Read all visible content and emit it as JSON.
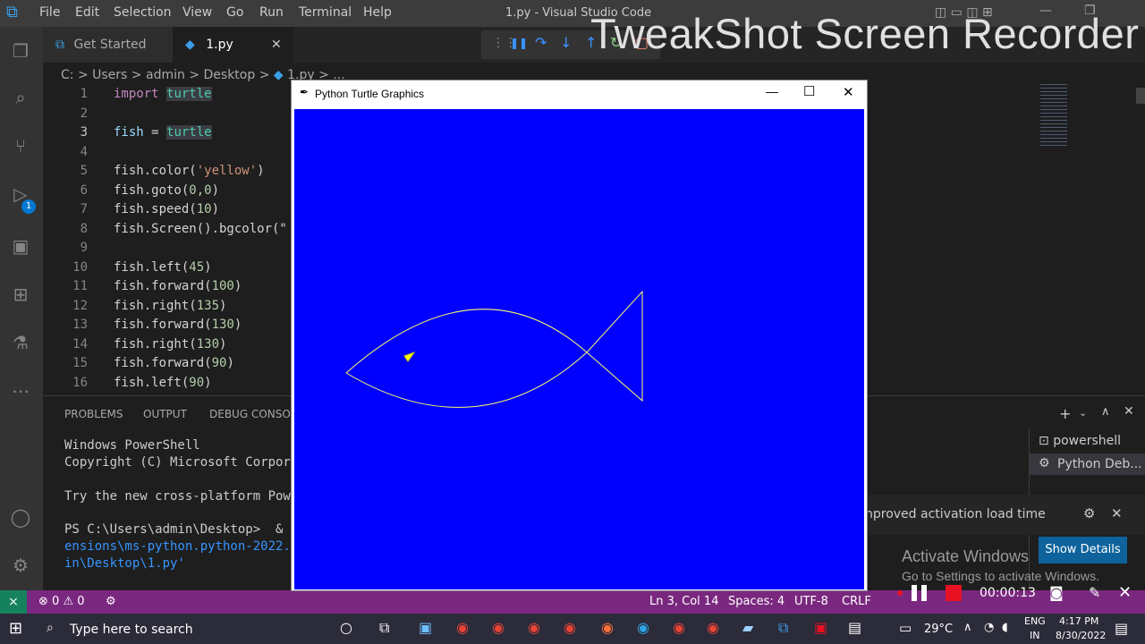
{
  "menu": [
    "File",
    "Edit",
    "Selection",
    "View",
    "Go",
    "Run",
    "Terminal",
    "Help"
  ],
  "window_title": "1.py - Visual Studio Code",
  "watermark": "TweakShot Screen Recorder",
  "activity": {
    "debug_badge": "1"
  },
  "tabs": [
    {
      "label": "Get Started"
    },
    {
      "label": "1.py"
    }
  ],
  "tab_close": "✕",
  "breadcrumb": [
    "C:",
    "Users",
    "admin",
    "Desktop",
    "1.py",
    "..."
  ],
  "editor": {
    "line_numbers": [
      "1",
      "2",
      "3",
      "4",
      "5",
      "6",
      "7",
      "8",
      "9",
      "10",
      "11",
      "12",
      "13",
      "14",
      "15",
      "16"
    ],
    "lines": {
      "l1_kw": "import",
      "l1_mod": "turtle",
      "l3_var": "fish",
      "l3_eq": " = ",
      "l3_mod": "turtle",
      "l5": "fish.color(",
      "l5_str": "'yellow'",
      "l5_end": ")",
      "l6": "fish.goto(",
      "l6_num": "0,0",
      "l6_end": ")",
      "l7": "fish.speed(",
      "l7_num": "10",
      "l7_end": ")",
      "l8": "fish.Screen().bgcolor(\"",
      "l10": "fish.left(",
      "l10_num": "45",
      "l10_end": ")",
      "l11": "fish.forward(",
      "l11_num": "100",
      "l11_end": ")",
      "l12": "fish.right(",
      "l12_num": "135",
      "l12_end": ")",
      "l13": "fish.forward(",
      "l13_num": "130",
      "l13_end": ")",
      "l14": "fish.right(",
      "l14_num": "130",
      "l14_end": ")",
      "l15": "fish.forward(",
      "l15_num": "90",
      "l15_end": ")",
      "l16": "fish.left(",
      "l16_num": "90",
      "l16_end": ")"
    }
  },
  "panel": {
    "tabs": [
      "PROBLEMS",
      "OUTPUT",
      "DEBUG CONSOL"
    ],
    "terminal_lines": [
      "Windows PowerShell",
      "Copyright (C) Microsoft Corpor",
      "Try the new cross-platform Pow",
      "PS C:\\Users\\admin\\Desktop>  &"
    ],
    "terminal_link1": "ensions\\ms-python.python-2022.",
    "terminal_link2": "in\\Desktop\\1.py'",
    "terminals": [
      "powershell",
      "Python Deb..."
    ]
  },
  "debug_toolbar": {
    "pause": "❚❚"
  },
  "turtle_window": {
    "title": "Python Turtle Graphics",
    "bg": "#0000ff",
    "pen": "#ffff00"
  },
  "notification": {
    "text": "nproved activation load time"
  },
  "activate": {
    "title": "Activate Windows",
    "sub": "Go to Settings to activate Windows.",
    "button": "Show Details"
  },
  "recorder": {
    "time": "00:00:13"
  },
  "status": {
    "errors": "0",
    "warnings": "0",
    "position": "Ln 3, Col 14",
    "spaces": "Spaces: 4",
    "encoding": "UTF-8",
    "eol": "CRLF"
  },
  "taskbar": {
    "search_placeholder": "Type here to search",
    "temp": "29°C",
    "lang1": "ENG",
    "lang2": "IN",
    "time": "4:17 PM",
    "date": "8/30/2022"
  }
}
